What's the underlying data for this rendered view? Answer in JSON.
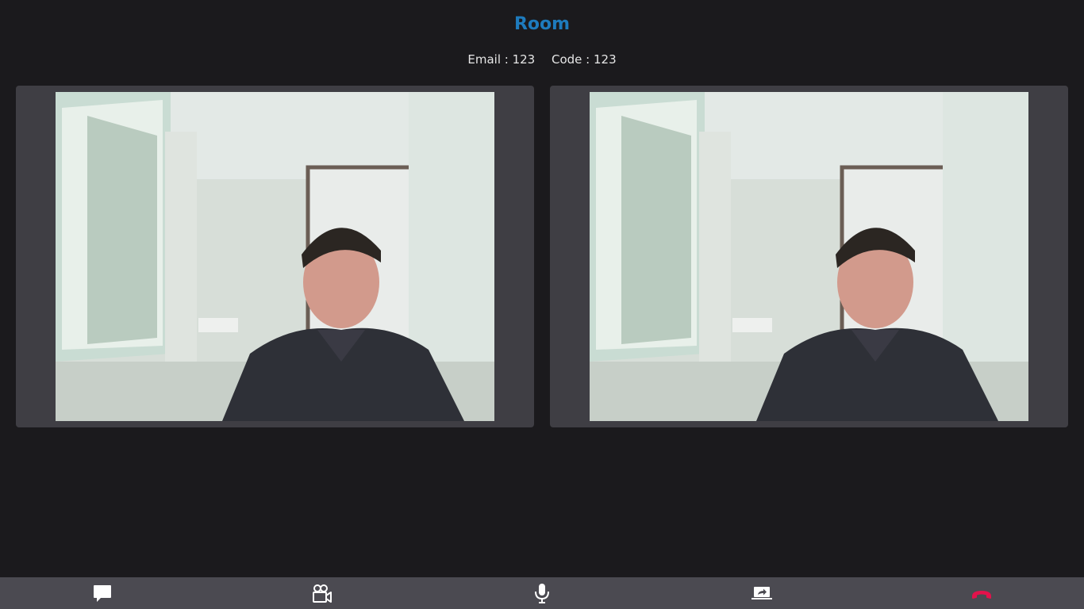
{
  "room": {
    "title": "Room"
  },
  "info": {
    "email_label": "Email : 123",
    "code_label": "Code : 123"
  },
  "videos": [
    {
      "name": "local-video"
    },
    {
      "name": "remote-video"
    }
  ],
  "toolbar": {
    "buttons": [
      {
        "name": "chat-button",
        "icon": "chat-bubble-icon"
      },
      {
        "name": "camera-button",
        "icon": "video-camera-icon"
      },
      {
        "name": "microphone-button",
        "icon": "microphone-icon"
      },
      {
        "name": "share-screen-button",
        "icon": "screen-share-icon"
      },
      {
        "name": "end-call-button",
        "icon": "hang-up-icon"
      }
    ]
  },
  "colors": {
    "background": "#1b1a1d",
    "title": "#1e7bbd",
    "tile": "#3f3e44",
    "toolbar": "#4b4a51",
    "end_call": "#e3124b"
  }
}
